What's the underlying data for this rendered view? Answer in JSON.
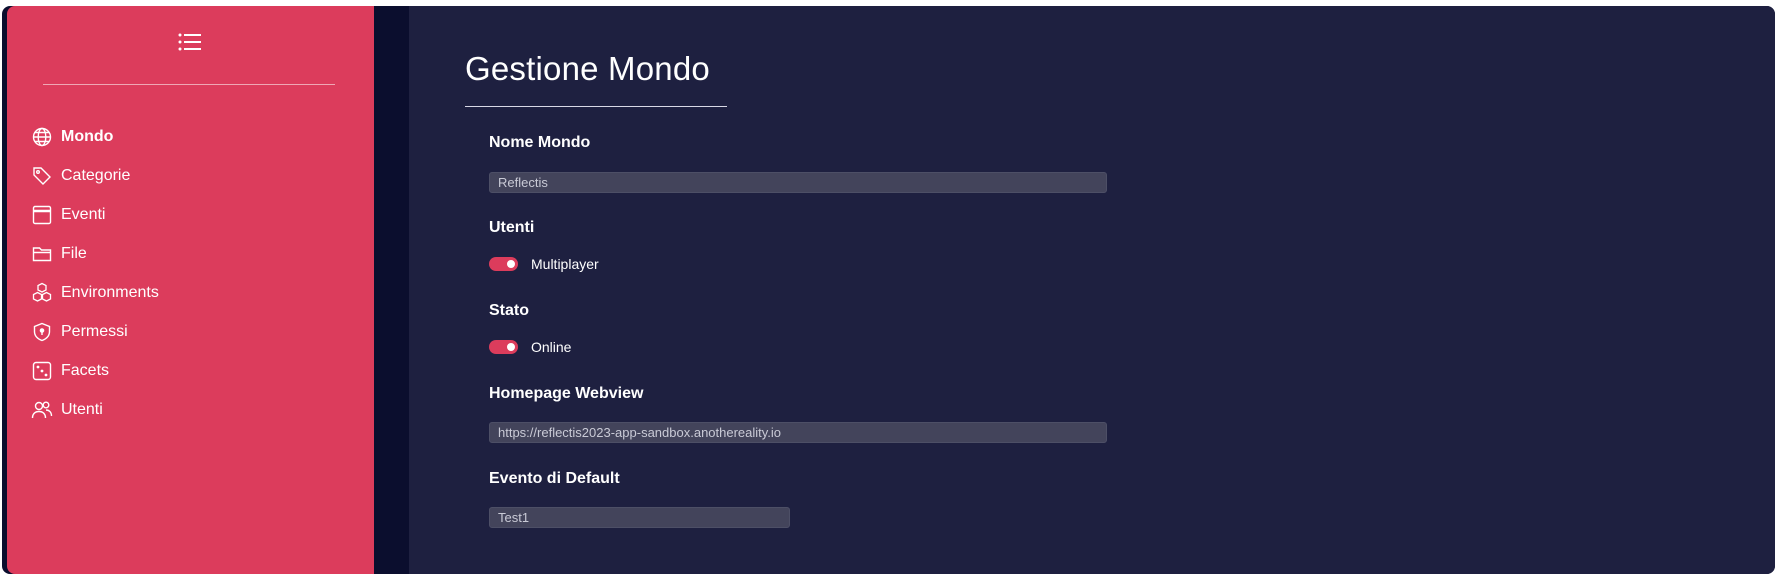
{
  "sidebar": {
    "menu_icon": "list-icon",
    "items": [
      {
        "label": "Mondo",
        "icon": "globe-icon",
        "active": true
      },
      {
        "label": "Categorie",
        "icon": "tag-icon"
      },
      {
        "label": "Eventi",
        "icon": "window-icon"
      },
      {
        "label": "File",
        "icon": "folder-icon"
      },
      {
        "label": "Environments",
        "icon": "boxes-icon"
      },
      {
        "label": "Permessi",
        "icon": "shield-icon"
      },
      {
        "label": "Facets",
        "icon": "dice-icon"
      },
      {
        "label": "Utenti",
        "icon": "people-icon"
      }
    ]
  },
  "main": {
    "title": "Gestione Mondo",
    "world_name": {
      "label": "Nome Mondo",
      "value": "Reflectis"
    },
    "users": {
      "label": "Utenti",
      "toggle_label": "Multiplayer",
      "checked": true
    },
    "status": {
      "label": "Stato",
      "toggle_label": "Online",
      "checked": true
    },
    "homepage": {
      "label": "Homepage Webview",
      "value": "https://reflectis2023-app-sandbox.anothereality.io"
    },
    "default_event": {
      "label": "Evento di Default",
      "value": "Test1"
    }
  },
  "colors": {
    "accent": "#dc3c5c",
    "panel": "#1e2040",
    "background": "#0b0e2e",
    "input": "#43445b"
  }
}
